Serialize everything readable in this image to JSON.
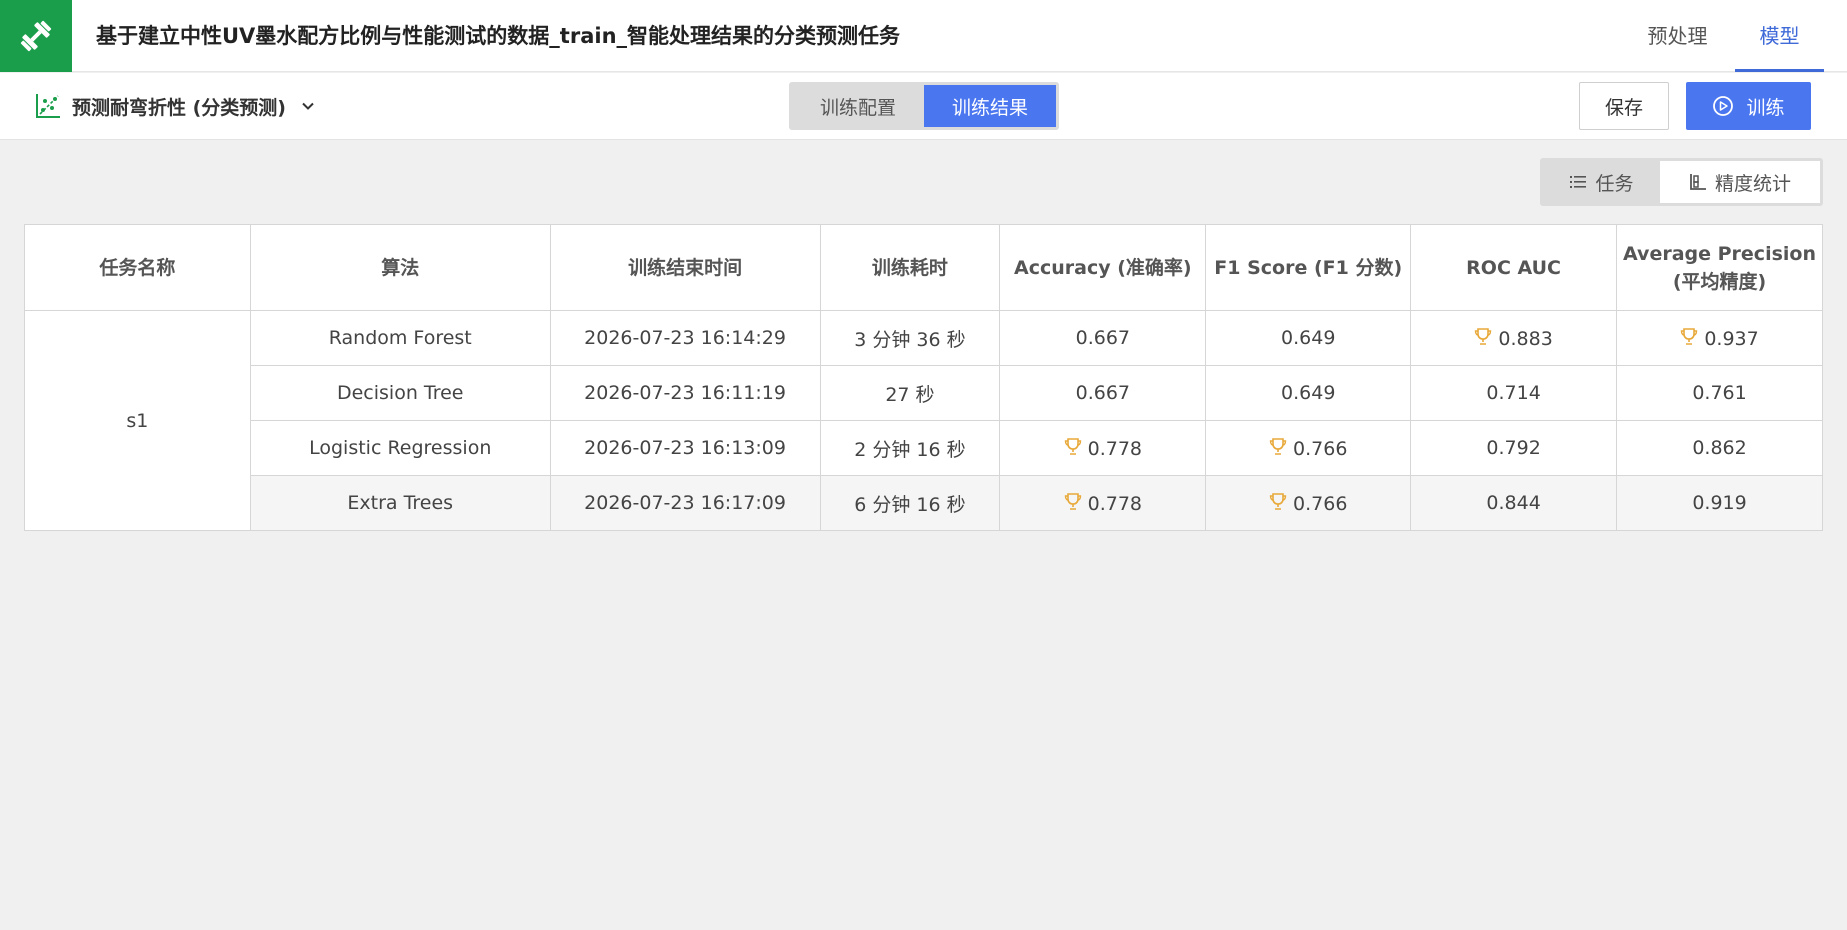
{
  "header": {
    "title": "基于建立中性UV墨水配方比例与性能测试的数据_train_智能处理结果的分类预测任务",
    "tabs": [
      {
        "label": "预处理",
        "active": false
      },
      {
        "label": "模型",
        "active": true
      }
    ]
  },
  "toolbar": {
    "task_label": "预测耐弯折性 (分类预测)",
    "segments": [
      {
        "label": "训练配置",
        "active": false
      },
      {
        "label": "训练结果",
        "active": true
      }
    ],
    "save_label": "保存",
    "train_label": "训练"
  },
  "view_toggle": {
    "task_label": "任务",
    "stats_label": "精度统计"
  },
  "table": {
    "columns": [
      "任务名称",
      "算法",
      "训练结束时间",
      "训练耗时",
      "Accuracy (准确率)",
      "F1 Score (F1 分数)",
      "ROC AUC",
      "Average Precision (平均精度)"
    ],
    "ap_line1": "Average Precision",
    "ap_line2": "(平均精度)",
    "task_name": "s1",
    "rows": [
      {
        "algorithm": "Random Forest",
        "end_time": "2026-07-23 16:14:29",
        "duration": "3 分钟 36 秒",
        "accuracy": "0.667",
        "f1": "0.649",
        "roc_auc": "0.883",
        "avg_precision": "0.937",
        "best": {
          "accuracy": false,
          "f1": false,
          "roc_auc": true,
          "avg_precision": true
        }
      },
      {
        "algorithm": "Decision Tree",
        "end_time": "2026-07-23 16:11:19",
        "duration": "27 秒",
        "accuracy": "0.667",
        "f1": "0.649",
        "roc_auc": "0.714",
        "avg_precision": "0.761",
        "best": {
          "accuracy": false,
          "f1": false,
          "roc_auc": false,
          "avg_precision": false
        }
      },
      {
        "algorithm": "Logistic Regression",
        "end_time": "2026-07-23 16:13:09",
        "duration": "2 分钟 16 秒",
        "accuracy": "0.778",
        "f1": "0.766",
        "roc_auc": "0.792",
        "avg_precision": "0.862",
        "best": {
          "accuracy": true,
          "f1": true,
          "roc_auc": false,
          "avg_precision": false
        }
      },
      {
        "algorithm": "Extra Trees",
        "end_time": "2026-07-23 16:17:09",
        "duration": "6 分钟 16 秒",
        "accuracy": "0.778",
        "f1": "0.766",
        "roc_auc": "0.844",
        "avg_precision": "0.919",
        "best": {
          "accuracy": true,
          "f1": true,
          "roc_auc": false,
          "avg_precision": false
        }
      }
    ]
  },
  "colors": {
    "brand_green": "#1b9e4b",
    "accent_blue": "#4a76f0",
    "tab_active": "#3f6ad8",
    "trophy": "#e8a93a"
  },
  "icons": {
    "logo": "dumbbell-icon",
    "task": "scatter-chart-icon",
    "dropdown": "chevron-down-icon",
    "train": "play-circle-icon",
    "list": "list-icon",
    "stats": "chart-stats-icon",
    "best": "trophy-icon"
  }
}
